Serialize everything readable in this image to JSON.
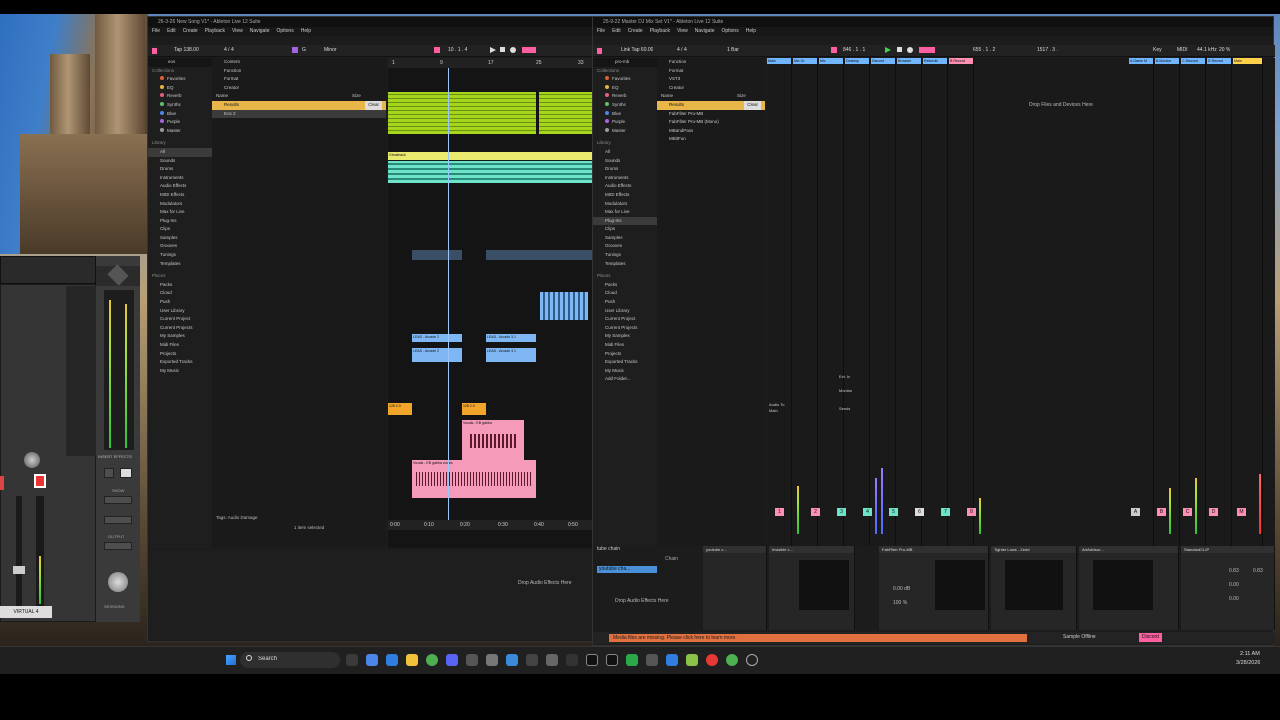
{
  "left_window": {
    "title": "26-3-26 New Song V1* - Ableton Live 12 Suite",
    "menus": [
      "File",
      "Edit",
      "Create",
      "Playback",
      "View",
      "Navigate",
      "Options",
      "Help"
    ],
    "tempo": "138.00",
    "signature": "4 / 4",
    "key": "G",
    "scale": "Minor",
    "position": "10 . 1 . 4",
    "search": "eos",
    "filters": [
      "Content",
      "Function",
      "Format",
      "Creator",
      "Name"
    ],
    "results_label": "Results",
    "clear_label": "Clear",
    "size_label": "Size",
    "result_item": "Eos 2",
    "collections_header": "Collections",
    "collections": [
      {
        "label": "Favorites",
        "color": "#e0612f"
      },
      {
        "label": "EQ",
        "color": "#e6b33b"
      },
      {
        "label": "Reverb",
        "color": "#e45f7c"
      },
      {
        "label": "Synths",
        "color": "#5fc06d"
      },
      {
        "label": "Blue",
        "color": "#4b86e8"
      },
      {
        "label": "Purple",
        "color": "#a466e0"
      },
      {
        "label": "Master",
        "color": "#9a9a9a"
      }
    ],
    "library_header": "Library",
    "library": [
      "All",
      "Sounds",
      "Drums",
      "Instruments",
      "Audio Effects",
      "MIDI Effects",
      "Modulators",
      "Max for Live",
      "Plug-Ins",
      "Clips",
      "Samples",
      "Grooves",
      "Tunings",
      "Templates"
    ],
    "places_header": "Places",
    "places": [
      "Packs",
      "Cloud",
      "Push",
      "User Library",
      "Current Project",
      "Current Projects",
      "My Samples",
      "Midi Files",
      "Projects",
      "Exported Tracks",
      "My Music"
    ],
    "tags_label": "Tags:",
    "tags_value": "Audio Damage",
    "status": "1 item selected",
    "ruler": [
      "1",
      "9",
      "17",
      "25",
      "33"
    ],
    "time_ruler": [
      "0:00",
      "0:10",
      "0:20",
      "0:30",
      "0:40",
      "0:50"
    ],
    "clips_lead": [
      "LEAD - Arcade 2",
      "LEAD - Arcade 3 1",
      "LEAD - Arcade 2",
      "LEAD - Arcade 3 1"
    ],
    "clips_ghost": "Ghosthack",
    "clips_vocal": [
      "Vocals - EB gabba",
      "Vocals - EB gabb",
      "Vocals - EB gabba vocals"
    ],
    "clips_orange": [
      "128 2.0",
      "128 2.0"
    ],
    "drop_audio": "Drop Audio Effects Here"
  },
  "right_window": {
    "title": "25-9-22 Master DJ Mix Set V1* - Ableton Live 12 Suite",
    "menus": [
      "File",
      "Edit",
      "Create",
      "Playback",
      "View",
      "Navigate",
      "Options",
      "Help"
    ],
    "tempo": "60.00",
    "signature": "4 / 4",
    "quant": "1 Bar",
    "position": "846 . 1 . 1",
    "end": "1517 . 3 .",
    "loop": "655 . 1 . 2",
    "key_label": "Key",
    "midi_label": "MIDI",
    "sample_rate": "44.1 kHz",
    "cpu": "20 %",
    "search": "pro-mb",
    "filters": [
      "Function",
      "Format",
      "VST3",
      "Creator",
      "Name"
    ],
    "results_label": "Results",
    "clear_label": "Clear",
    "size_label": "Size",
    "results": [
      "FabFilter Pro-MB",
      "FabFilter Pro-MB (Mono)",
      "MBandPass",
      "MBitFun"
    ],
    "collections_header": "Collections",
    "collections": [
      {
        "label": "Favorites",
        "color": "#e0612f"
      },
      {
        "label": "EQ",
        "color": "#e6b33b"
      },
      {
        "label": "Reverb",
        "color": "#e45f7c"
      },
      {
        "label": "Synths",
        "color": "#5fc06d"
      },
      {
        "label": "Blue",
        "color": "#4b86e8"
      },
      {
        "label": "Purple",
        "color": "#a466e0"
      },
      {
        "label": "Master",
        "color": "#9a9a9a"
      }
    ],
    "library_header": "Library",
    "library": [
      "All",
      "Sounds",
      "Drums",
      "Instruments",
      "Audio Effects",
      "MIDI Effects",
      "Modulators",
      "Max for Live",
      "Plug-Ins",
      "Clips",
      "Samples",
      "Grooves",
      "Tunings",
      "Templates"
    ],
    "places_header": "Places",
    "places": [
      "Packs",
      "Cloud",
      "Push",
      "User Library",
      "Current Project",
      "Current Projects",
      "My Samples",
      "Midi Files",
      "Projects",
      "Exported Tracks",
      "My Music",
      "Add Folder..."
    ],
    "tracks": [
      {
        "name": "Main",
        "color": "#6fb5ff"
      },
      {
        "name": "Mix Gr",
        "color": "#6fb5ff"
      },
      {
        "name": "Mic",
        "color": "#6fb5ff"
      },
      {
        "name": "Desktop",
        "color": "#6fb5ff"
      },
      {
        "name": "Discord",
        "color": "#6fb5ff"
      },
      {
        "name": "Browser",
        "color": "#6fb5ff"
      },
      {
        "name": "Rekordb",
        "color": "#6fb5ff"
      },
      {
        "name": "B Record",
        "color": "#ff8fb3"
      }
    ],
    "return_tracks": [
      {
        "name": "A Game M",
        "color": "#6fb5ff"
      },
      {
        "name": "B Monitor",
        "color": "#6fb5ff"
      },
      {
        "name": "C Discord",
        "color": "#6fb5ff"
      },
      {
        "name": "D Record",
        "color": "#6fb5ff"
      },
      {
        "name": "Main",
        "color": "#ffd04a"
      }
    ],
    "track_numbers": [
      "1",
      "2",
      "3",
      "4",
      "5",
      "6",
      "7",
      "8"
    ],
    "return_letters": [
      "A",
      "B",
      "C",
      "D",
      "M"
    ],
    "drop_files": "Drop Files and Devices Here",
    "input_label": "Ext. In",
    "monitor_label": "Monitor",
    "audio_to": "Audio To",
    "main_label": "Main",
    "sends_label": "Sends",
    "chain_title": "tube chain",
    "chain_name": "Chain",
    "chain_item": "youtube cha...",
    "drop_audio": "Drop Audio Effects Here",
    "devices": [
      "youtube c...",
      "Invisible L...",
      "FabFilter Pro-MB",
      "Tighter Lows - Zedd",
      "ArtAdvisor...",
      "StandardCLIP"
    ],
    "device_params": {
      "gain": "0.00 dB",
      "mix": "100 %",
      "input_gain": "0.83",
      "output_gain": "0.83",
      "softness": "0.00",
      "ceiling": "0.00"
    },
    "warning": "Media files are missing. Please click here to learn more.",
    "sample_offline": "Sample Offline",
    "discord": "Discord"
  },
  "uad": {
    "label": "VIRTUAL 4",
    "insert_effects": "INSERT EFFECTS",
    "output": "OUTPUT",
    "show": "SHOW",
    "sessions": "SESSIONS"
  },
  "taskbar": {
    "search": "Search",
    "time": "2:11 AM",
    "date": "3/28/2026"
  }
}
